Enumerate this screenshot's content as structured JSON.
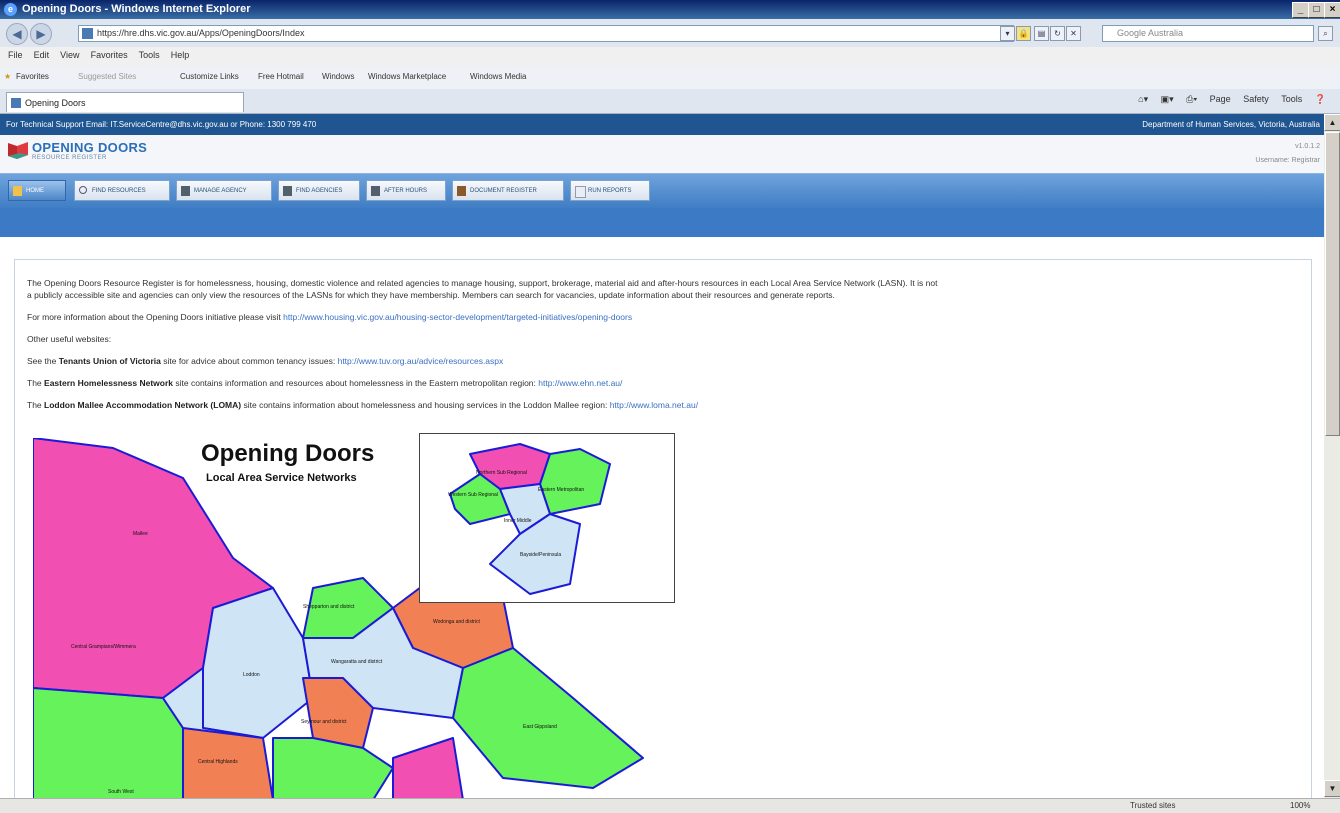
{
  "window": {
    "title": "Opening Doors - Windows Internet Explorer"
  },
  "toolbar": {
    "address": "https://hre.dhs.vic.gov.au/Apps/OpeningDoors/Index",
    "search_placeholder": "Google Australia"
  },
  "menu": [
    "File",
    "Edit",
    "View",
    "Favorites",
    "Tools",
    "Help"
  ],
  "favorites": {
    "label": "Favorites",
    "items": [
      "Suggested Sites",
      "Customize Links",
      "Free Hotmail",
      "Windows",
      "Windows Marketplace",
      "Windows Media"
    ]
  },
  "tab": {
    "title": "Opening Doors"
  },
  "command_bar": {
    "page": "Page",
    "safety": "Safety",
    "tools": "Tools"
  },
  "support": {
    "text": "For Technical Support Email: IT.ServiceCentre@dhs.vic.gov.au or Phone: 1300 799 470",
    "department": "Department of Human Services, Victoria, Australia"
  },
  "brand": {
    "title": "OPENING DOORS",
    "subtitle": "RESOURCE REGISTER",
    "version": "v1.0.1.2",
    "user": "Username: Registrar"
  },
  "nav": {
    "home": "HOME",
    "find_resources": "FIND RESOURCES",
    "manage_agency": "MANAGE AGENCY",
    "find_agencies": "FIND AGENCIES",
    "after_hours": "AFTER HOURS",
    "document_register": "DOCUMENT REGISTER",
    "run_reports": "RUN REPORTS"
  },
  "content": {
    "intro1": "The Opening Doors Resource Register is for homelessness, housing, domestic violence and related agencies to manage housing, support, brokerage, material aid and after-hours resources in each Local Area Service Network (LASN). It is not",
    "intro2": "a publicly accessible site and agencies can only view the resources of the LASNs for which they have membership. Members can search for vacancies, update information about their resources and generate reports.",
    "more_info": "For more information about the Opening Doors initiative please visit",
    "more_info_link": "http://www.housing.vic.gov.au/housing-sector-development/targeted-initiatives/opening-doors",
    "other_sites": "Other useful websites:",
    "tuv_pre": "See the",
    "tuv_name": "Tenants Union of Victoria",
    "tuv_post": "site for advice about common tenancy issues:",
    "tuv_link": "http://www.tuv.org.au/advice/resources.aspx",
    "ehn_pre": "The",
    "ehn_name": "Eastern Homelessness Network",
    "ehn_post": "site contains information and resources about homelessness in the Eastern metropolitan region:",
    "ehn_link": "http://www.ehn.net.au/",
    "loma_pre": "The",
    "loma_name": "Loddon Mallee Accommodation Network (LOMA)",
    "loma_post": "site contains information about homelessness and housing services in the Loddon Mallee region:",
    "loma_link": "http://www.loma.net.au/"
  },
  "map": {
    "title": "Opening Doors",
    "subtitle": "Local Area Service Networks",
    "regions": [
      "Mallee",
      "Central Grampians/Wimmera",
      "Loddon",
      "Wangaratta and district",
      "Shepparton and district",
      "Wodonga and district",
      "Seymour and district",
      "Central Highlands",
      "East Gippsland",
      "South West"
    ],
    "inset_regions": [
      "Northern Sub Regional",
      "Western Sub Regional",
      "Eastern Metropolitan",
      "Inner Middle",
      "Bayside/Peninsula"
    ],
    "colors": {
      "magenta": "#f24fb2",
      "green": "#66f25a",
      "lightblue": "#cfe5f5",
      "orange": "#f28055",
      "border": "#1b1bd6"
    }
  },
  "status": {
    "zone": "Trusted sites",
    "zoom": "100%"
  }
}
